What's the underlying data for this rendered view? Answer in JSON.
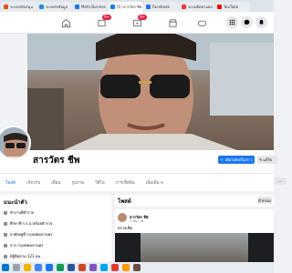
{
  "browser": {
    "tabs": [
      {
        "label": "ระบบสนับสนุน",
        "color": "#e65100"
      },
      {
        "label": "ระบบส่งข้อมูล",
        "color": "#1e88e5"
      },
      {
        "label": "Meta Business Suite",
        "color": "#1877f2"
      },
      {
        "label": "(1) สารวัตร ชีพ | Facebook",
        "color": "#1877f2",
        "active": true
      },
      {
        "label": "Facebook",
        "color": "#1877f2"
      },
      {
        "label": "ระบบติดตามผลงาน",
        "color": "#e53935"
      },
      {
        "label": "YouTube",
        "color": "#ff0000"
      }
    ]
  },
  "fb_nav": {
    "home_icon": "home-icon",
    "friends_icon": "friends-icon",
    "friends_badge": "9+",
    "video_icon": "video-icon",
    "video_badge": "9+",
    "marketplace_icon": "marketplace-icon",
    "gaming_icon": "gaming-icon",
    "menu_icon": "grid-menu-icon",
    "messenger_icon": "messenger-icon",
    "notifications_icon": "bell-icon"
  },
  "profile": {
    "name": "สารวัตร ชีพ",
    "primary_button": "เพิ่มไปยังเรื่องราว",
    "secondary_button": "แก้ไข",
    "accent": "#1877f2"
  },
  "profile_tabs": [
    {
      "label": "โพสต์",
      "active": true
    },
    {
      "label": "เกี่ยวกับ"
    },
    {
      "label": "เพื่อน"
    },
    {
      "label": "รูปภาพ"
    },
    {
      "label": "วิดีโอ"
    },
    {
      "label": "การเช็คอิน"
    },
    {
      "label": "เพิ่มเติม ▾"
    }
  ],
  "intro": {
    "title": "แนะนำตัว",
    "rows": [
      "ทำงานที่ตำรวจ",
      "ศึกษาที่ ร.ร.นายร้อยตำรวจ",
      "อาศัยอยู่ที่ กรุงเทพมหานคร",
      "จาก กรุงเทพมหานคร",
      "มีผู้ติดตาม 121 คน"
    ]
  },
  "posts": {
    "title": "โพสต์",
    "filter_button": "ตัวกรอง",
    "post": {
      "author": "สารวัตร ชีพ",
      "time": "1 ชม. · ",
      "caption": "ตรวจเช็ค"
    }
  }
}
